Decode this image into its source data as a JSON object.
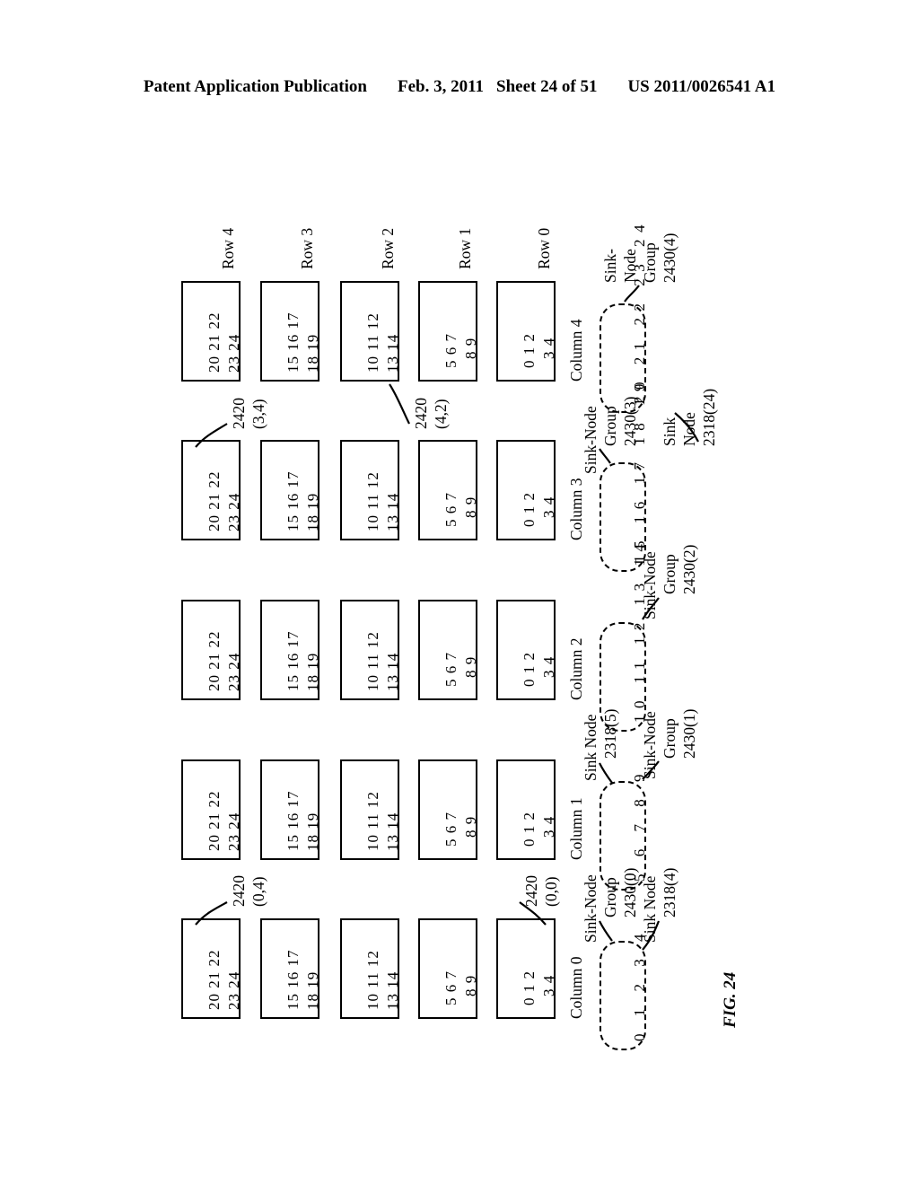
{
  "header": {
    "publication": "Patent Application Publication",
    "date": "Feb. 3, 2011",
    "sheet": "Sheet 24 of 51",
    "patent_number": "US 2011/0026541 A1"
  },
  "figure": {
    "fig_number": "FIG. 24",
    "row_labels": [
      "Row 4",
      "Row 3",
      "Row 2",
      "Row 1",
      "Row 0"
    ],
    "column_labels": [
      "Column 4",
      "Column 3",
      "Column 2",
      "Column 1",
      "Column 0"
    ],
    "node_box_lines": {
      "row4": {
        "line1": "20 21 22",
        "line2": "23 24"
      },
      "row3": {
        "line1": "15 16 17",
        "line2": "18 19"
      },
      "row2": {
        "line1": "10 11 12",
        "line2": "13 14"
      },
      "row1": {
        "line1": "5  6  7",
        "line2": "8  9"
      },
      "row0": {
        "line1": "0  1  2",
        "line2": "3  4"
      }
    },
    "grid_refs": [
      {
        "id": "ref-2420-3-4",
        "line1": "2420",
        "line2": "(3,4)"
      },
      {
        "id": "ref-2420-4-2",
        "line1": "2420",
        "line2": "(4,2)"
      },
      {
        "id": "ref-2420-0-4",
        "line1": "2420",
        "line2": "(0,4)"
      },
      {
        "id": "ref-2420-0-0",
        "line1": "2420",
        "line2": "(0,0)"
      }
    ],
    "sink_groups": [
      {
        "id": "sink-node-group-2430-4",
        "members": "20 21 22 23 24",
        "label_lines": [
          "Sink-",
          "Node",
          "Group",
          "2430(4)"
        ]
      },
      {
        "id": "sink-node-group-2430-3",
        "members": "15 16 17 18 19",
        "label_lines": [
          "Sink-Node",
          "Group",
          "2430(3)"
        ]
      },
      {
        "id": "sink-node-group-2430-2",
        "members": "10 11 12 13 14",
        "label_lines": [
          "Sink-Node",
          "Group",
          "2430(2)"
        ]
      },
      {
        "id": "sink-node-group-2430-1",
        "members": "5  6  7  8  9",
        "label_lines": [
          "Sink-Node",
          "Group",
          "2430(1)"
        ]
      },
      {
        "id": "sink-node-group-2430-0",
        "members": "0  1  2  3  4",
        "label_lines": [
          "Sink-Node",
          "Group",
          "2430(0)"
        ]
      }
    ],
    "sink_node_refs": [
      {
        "id": "sink-node-2318-24",
        "label_lines": [
          "Sink",
          "Node",
          "2318(24)"
        ]
      },
      {
        "id": "sink-node-2318-5",
        "label_lines": [
          "Sink Node",
          "2318(5)"
        ]
      },
      {
        "id": "sink-node-2318-4",
        "label_lines": [
          "Sink Node",
          "2318(4)"
        ]
      }
    ]
  }
}
